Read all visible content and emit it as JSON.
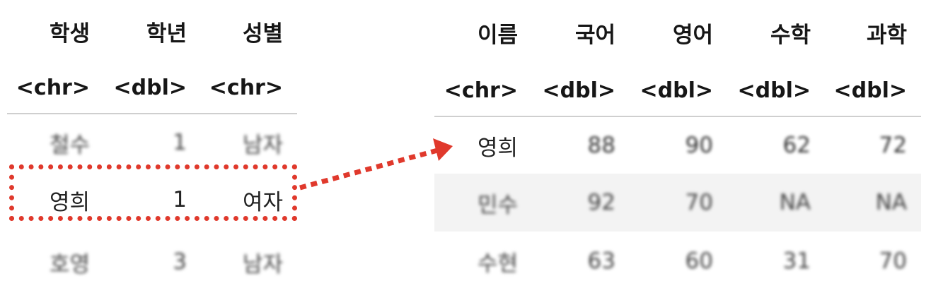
{
  "left_table": {
    "headers": [
      "학생",
      "학년",
      "성별"
    ],
    "types": [
      "<chr>",
      "<dbl>",
      "<chr>"
    ],
    "rows": [
      [
        "철수",
        "1",
        "남자"
      ],
      [
        "영희",
        "1",
        "여자"
      ],
      [
        "호영",
        "3",
        "남자"
      ]
    ]
  },
  "right_table": {
    "headers": [
      "이름",
      "국어",
      "영어",
      "수학",
      "과학"
    ],
    "types": [
      "<chr>",
      "<dbl>",
      "<dbl>",
      "<dbl>",
      "<dbl>"
    ],
    "rows": [
      [
        "영희",
        "88",
        "90",
        "62",
        "72"
      ],
      [
        "민수",
        "92",
        "70",
        "NA",
        "NA"
      ],
      [
        "수현",
        "63",
        "60",
        "31",
        "70"
      ]
    ]
  },
  "colors": {
    "highlight": "#e0392c",
    "rule": "#cfcfcf",
    "shaded_row": "#f3f3f3"
  }
}
